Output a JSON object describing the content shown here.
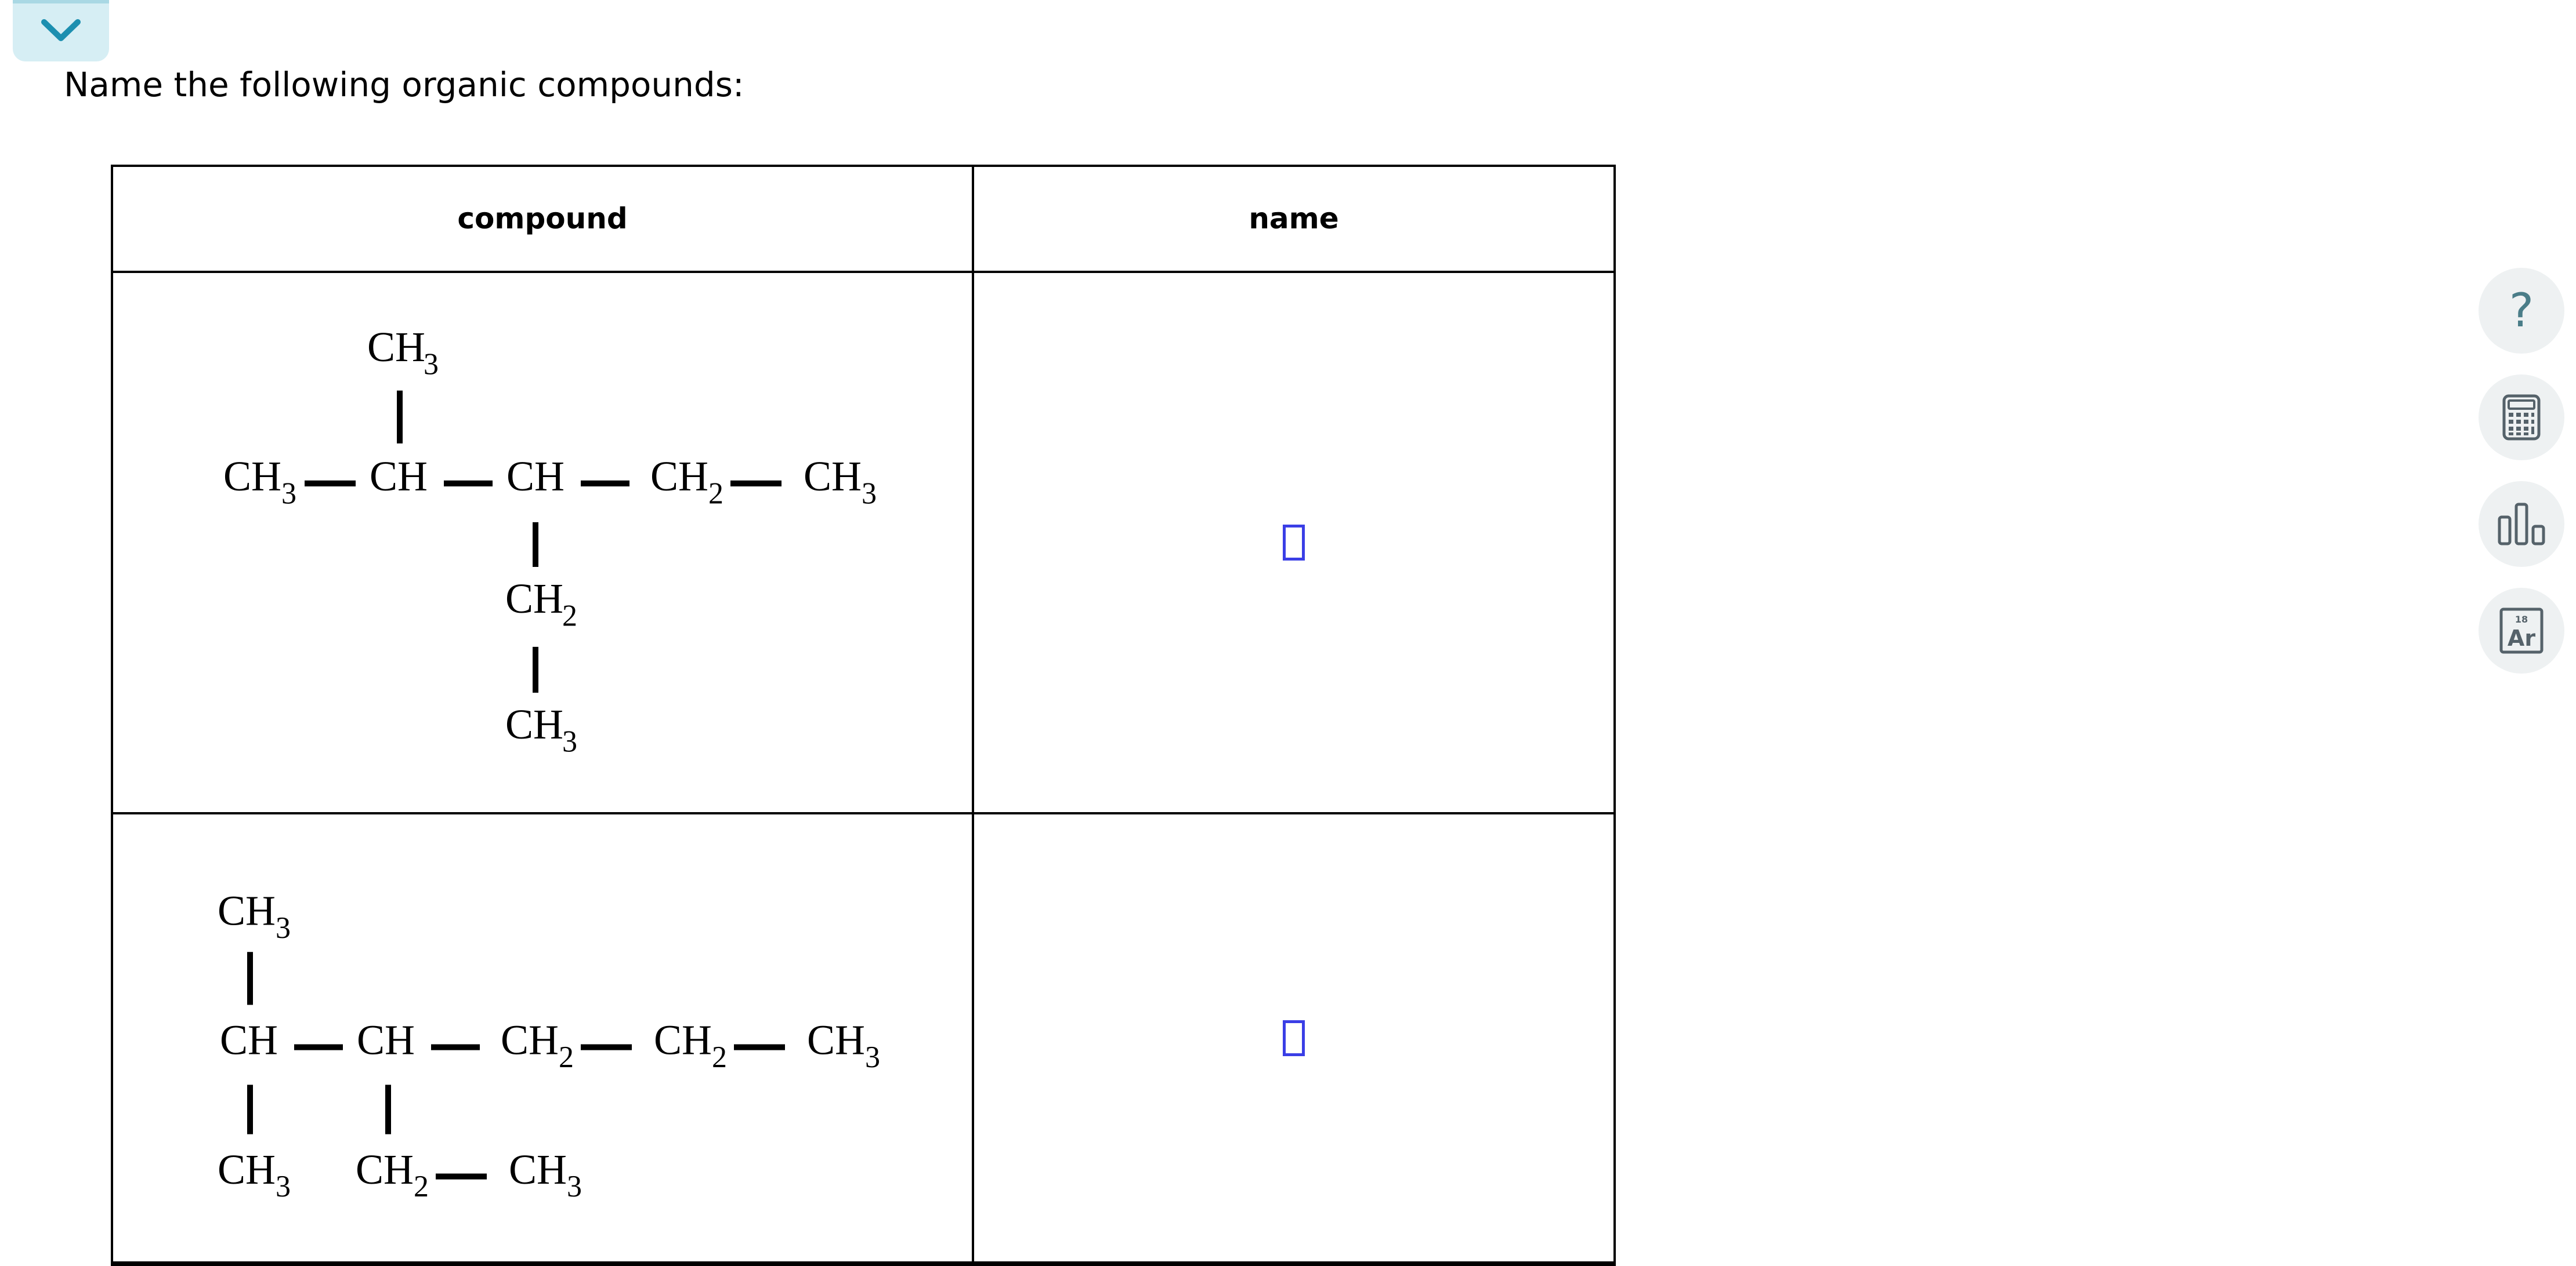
{
  "header": {
    "collapse_icon": "chevron-down-icon",
    "prompt": "Name the following organic compounds:"
  },
  "table": {
    "headers": [
      "compound",
      "name"
    ],
    "rows": [
      {
        "compound": {
          "CH3_top": "CH",
          "sub_top": "3",
          "main_chain": [
            {
              "base": "CH",
              "sub": "3"
            },
            {
              "base": "CH",
              "sub": ""
            },
            {
              "base": "CH",
              "sub": ""
            },
            {
              "base": "CH",
              "sub": "2"
            },
            {
              "base": "CH",
              "sub": "3"
            }
          ],
          "branch_mid": {
            "base": "CH",
            "sub": "2"
          },
          "branch_low": {
            "base": "CH",
            "sub": "3"
          }
        },
        "name": ""
      },
      {
        "compound": {
          "top": {
            "base": "CH",
            "sub": "3"
          },
          "main_chain": [
            {
              "base": "CH",
              "sub": ""
            },
            {
              "base": "CH",
              "sub": ""
            },
            {
              "base": "CH",
              "sub": "2"
            },
            {
              "base": "CH",
              "sub": "2"
            },
            {
              "base": "CH",
              "sub": "3"
            }
          ],
          "bottom_left": {
            "base": "CH",
            "sub": "3"
          },
          "bottom_mid": {
            "base": "CH",
            "sub": "2"
          },
          "bottom_right": {
            "base": "CH",
            "sub": "3"
          }
        },
        "name": ""
      }
    ]
  },
  "tools": [
    {
      "name": "help-icon",
      "glyph": "?"
    },
    {
      "name": "calculator-icon"
    },
    {
      "name": "bar-chart-icon"
    },
    {
      "name": "periodic-table-icon",
      "number": "18",
      "symbol": "Ar"
    }
  ]
}
